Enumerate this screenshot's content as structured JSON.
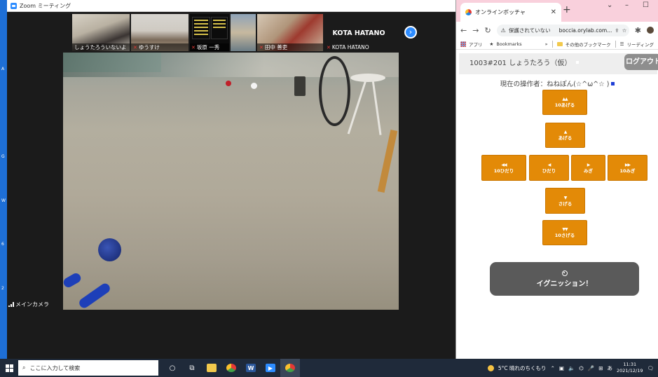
{
  "zoom": {
    "window_title": "Zoom ミーティング",
    "participants": [
      {
        "name": "しょうたろういないよ",
        "muted": false
      },
      {
        "name": "ゆうすけ",
        "muted": true
      },
      {
        "name": "",
        "muted": false
      },
      {
        "name": "",
        "muted": false
      },
      {
        "name": "田中 善吏",
        "muted": true
      },
      {
        "name": "KOTA HATANO",
        "muted": true
      }
    ],
    "name_on_tile": "KOTA HATANO",
    "name_thumb_3_4": "坂原 一秀",
    "main_camera_label": "メインカメラ"
  },
  "chrome": {
    "tab_title": "オンラインボッチャ",
    "address_warning": "保護されていない",
    "url": "boccia.orylab.com...",
    "bookmarks": {
      "apps": "アプリ",
      "bookmarks": "Bookmarks",
      "more": "»",
      "other": "その他のブックマーク",
      "reading_list": "リーディング"
    },
    "room_label": "1003#201 しょうたろう（仮）",
    "logout_label": "ログアウト",
    "operator_text": "現在の操作者：ねねぽん(☆^ω^☆ )",
    "controls": {
      "up10": {
        "arrow": "▲▲",
        "label": "10あげる"
      },
      "up": {
        "arrow": "▲",
        "label": "あげる"
      },
      "left10": {
        "arrow": "◀◀",
        "label": "10ひだり"
      },
      "left": {
        "arrow": "◀",
        "label": "ひだり"
      },
      "right": {
        "arrow": "▶",
        "label": "みぎ"
      },
      "right10": {
        "arrow": "▶▶",
        "label": "10みぎ"
      },
      "down": {
        "arrow": "▼",
        "label": "さげる"
      },
      "down10": {
        "arrow": "▼▼",
        "label": "10さげる"
      }
    },
    "ignition_label": "イグニッション！"
  },
  "taskbar": {
    "search_placeholder": "ここに入力して検索",
    "weather": "5°C 晴れのちくもり",
    "time": "11:31",
    "date": "2021/12/19",
    "ime": "あ"
  },
  "colors": {
    "control_orange": "#e38a07",
    "ignite_gray": "#5a5a5a",
    "zoom_blue": "#2d8cff",
    "chrome_tab_pink": "#f9d0dc"
  }
}
